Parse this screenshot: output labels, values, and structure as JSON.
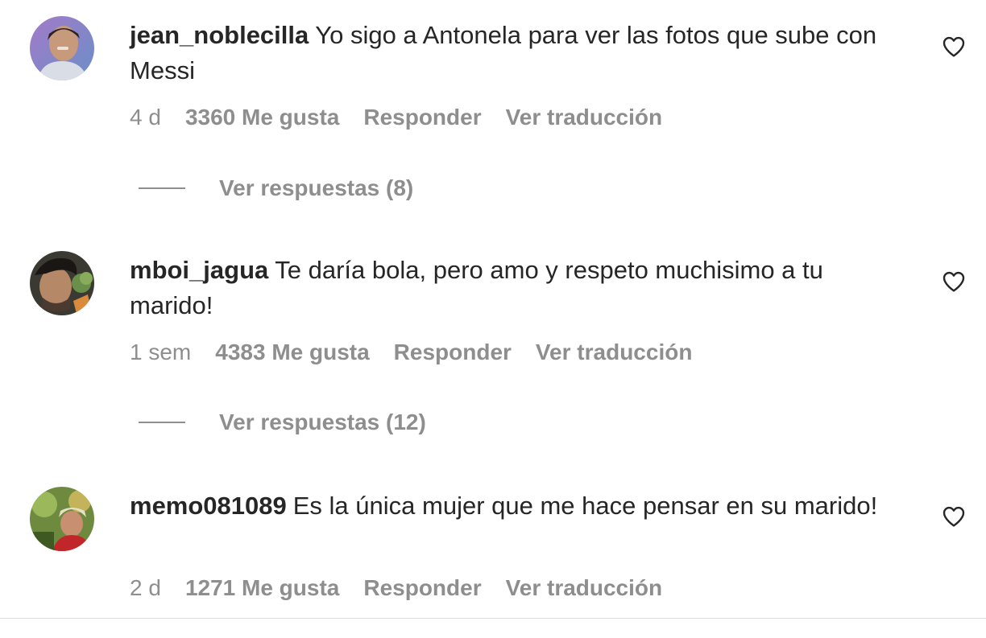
{
  "comments": [
    {
      "username": "jean_noblecilla",
      "text": "Yo sigo a Antonela para ver las fotos que sube con Messi",
      "time": "4 d",
      "likes": "3360 Me gusta",
      "reply": "Responder",
      "translate": "Ver traducción",
      "replies": "Ver respuestas (8)",
      "avatar_icon": "avatar-photo",
      "heart_icon": "heart-outline-icon"
    },
    {
      "username": "mboi_jagua",
      "text": "Te daría bola, pero amo y respeto muchisimo a tu marido!",
      "time": "1 sem",
      "likes": "4383 Me gusta",
      "reply": "Responder",
      "translate": "Ver traducción",
      "replies": "Ver respuestas (12)",
      "avatar_icon": "avatar-photo",
      "heart_icon": "heart-outline-icon"
    },
    {
      "username": "memo081089",
      "text": "Es la única mujer que me hace pensar en su marido!",
      "time": "2 d",
      "likes": "1271 Me gusta",
      "reply": "Responder",
      "translate": "Ver traducción",
      "avatar_icon": "avatar-photo",
      "heart_icon": "heart-outline-icon"
    }
  ],
  "colors": {
    "text_primary": "#262626",
    "text_secondary": "#8e8e8e",
    "divider": "#dbdbdb"
  }
}
